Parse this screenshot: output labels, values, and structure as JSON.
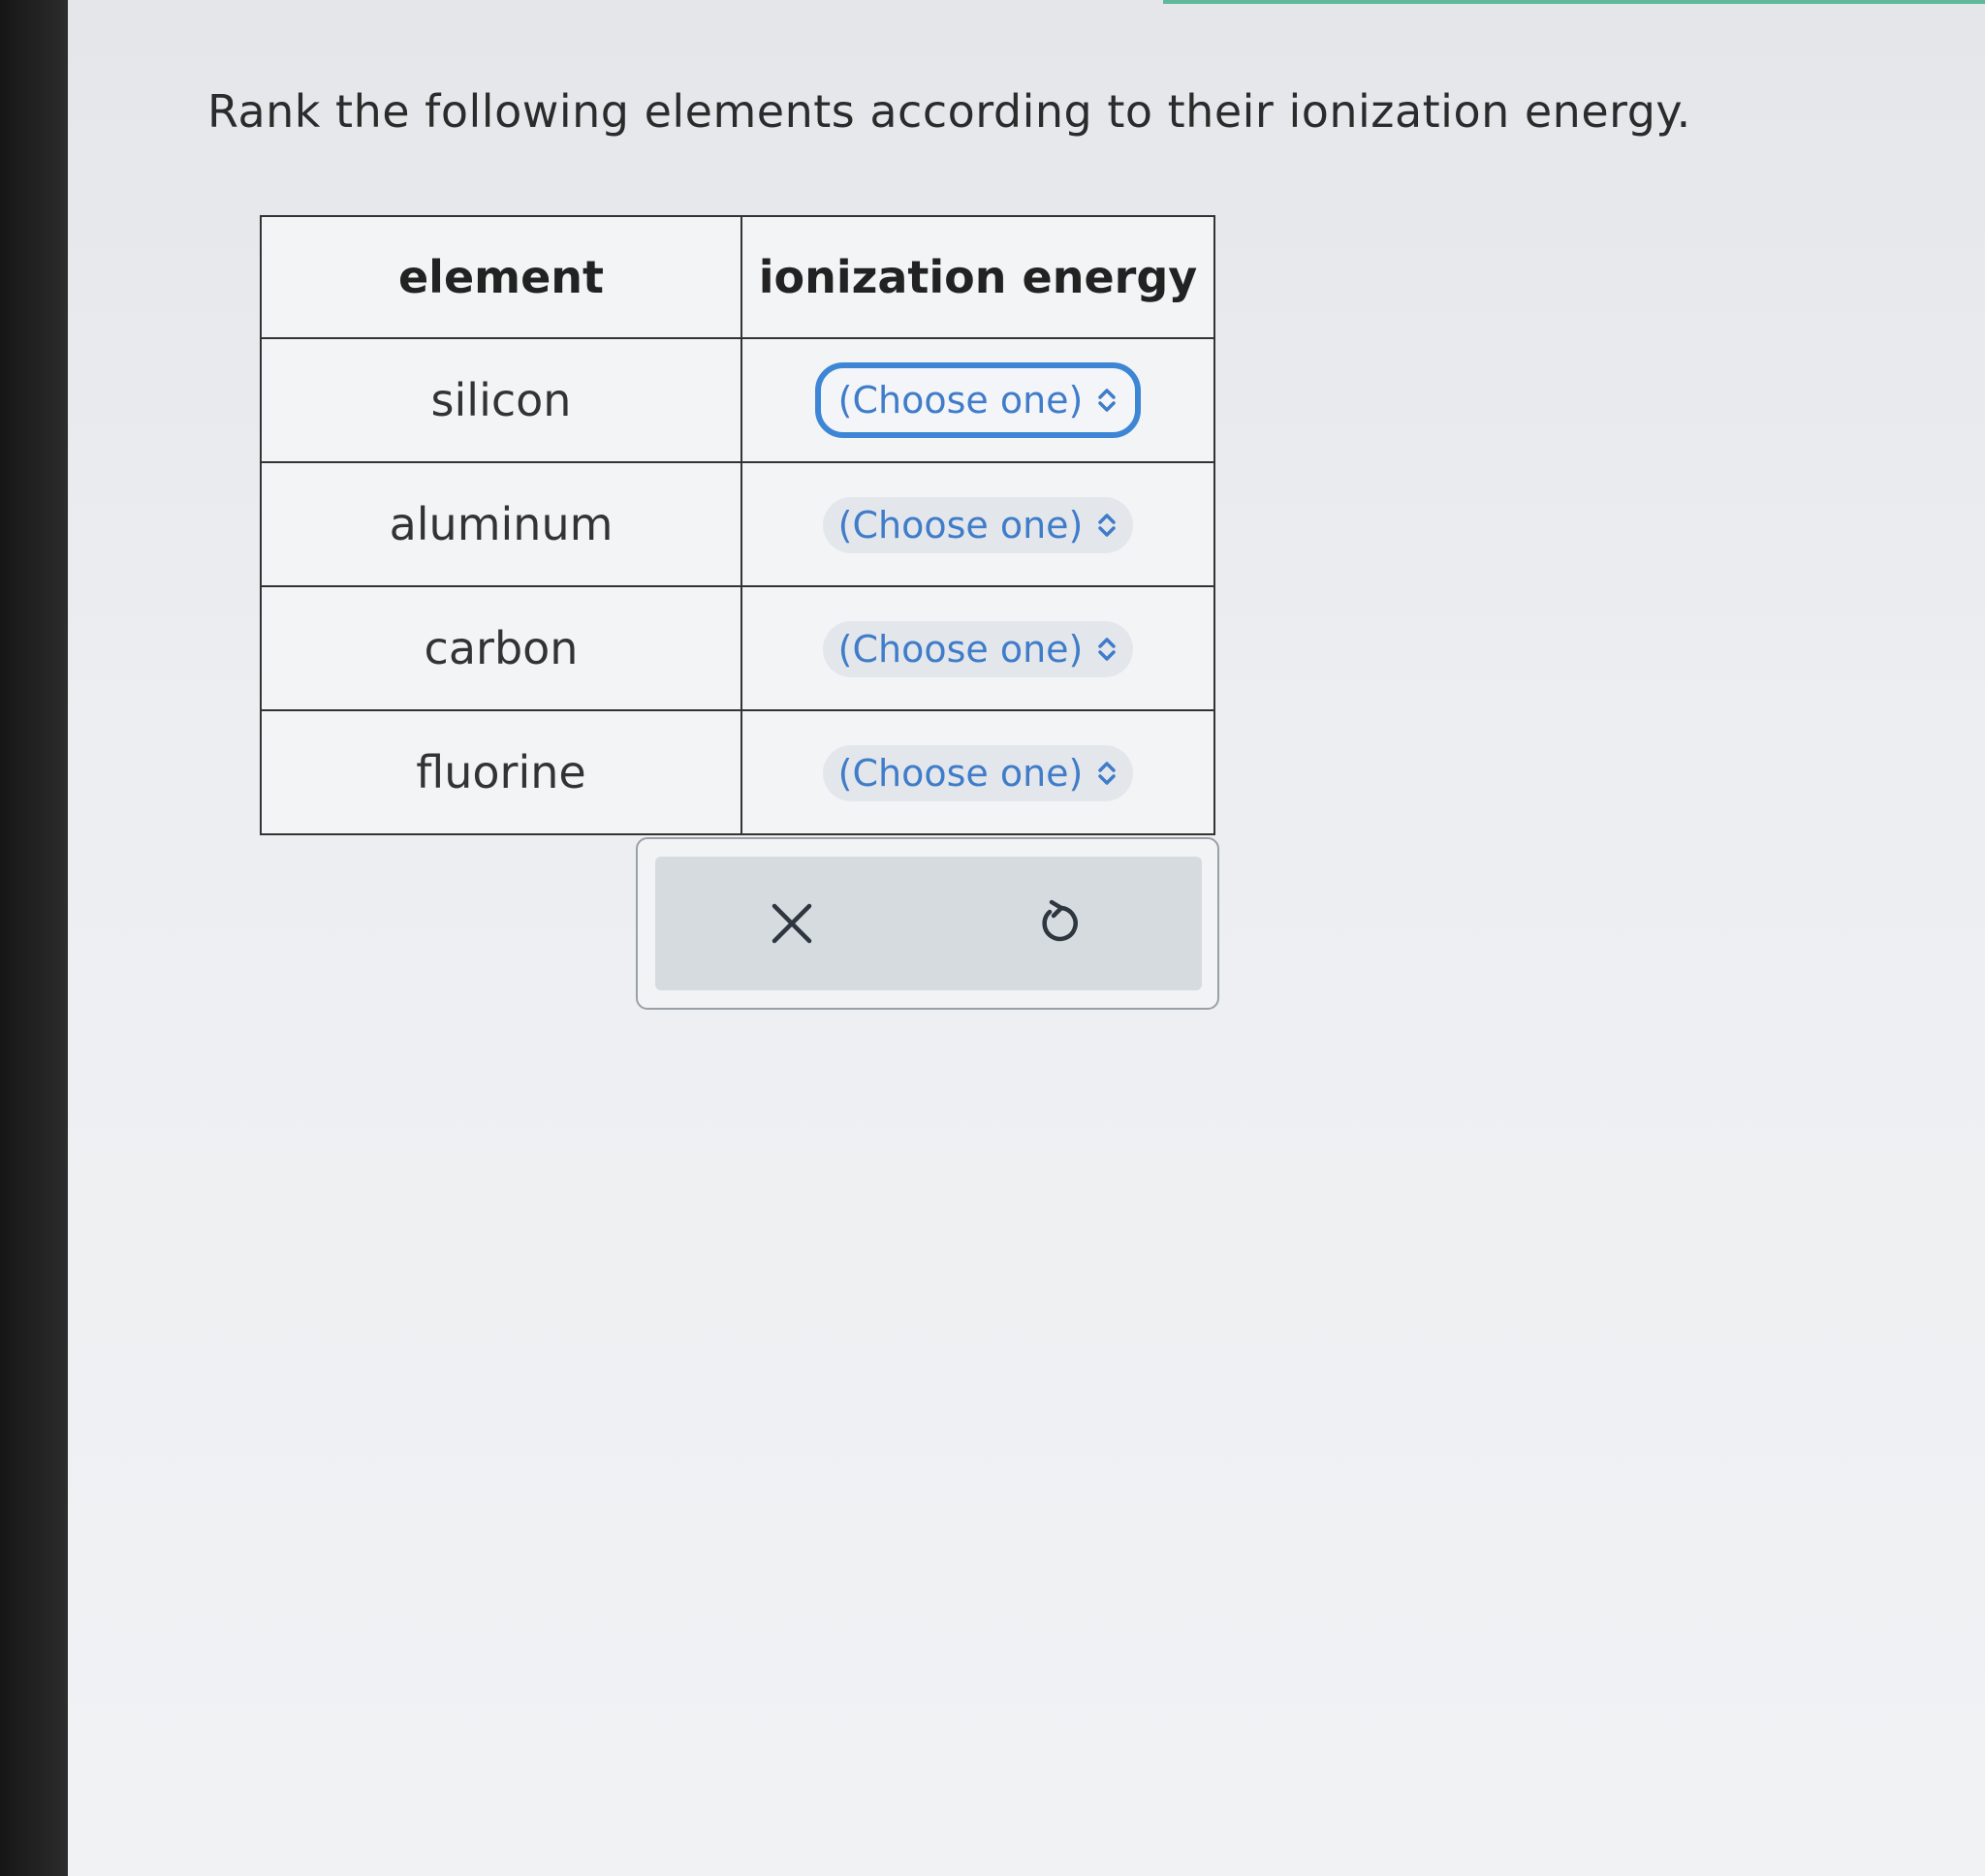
{
  "question": "Rank the following elements according to their ionization energy.",
  "table": {
    "headers": [
      "element",
      "ionization energy"
    ],
    "rows": [
      {
        "element": "silicon",
        "selection": "(Choose one)"
      },
      {
        "element": "aluminum",
        "selection": "(Choose one)"
      },
      {
        "element": "carbon",
        "selection": "(Choose one)"
      },
      {
        "element": "fluorine",
        "selection": "(Choose one)"
      }
    ]
  },
  "actions": {
    "clear_icon": "close-icon",
    "undo_icon": "undo-icon"
  },
  "colors": {
    "select_text": "#3f7cc9",
    "focus_ring": "#3d86d6",
    "top_accent": "#5fb89a"
  }
}
